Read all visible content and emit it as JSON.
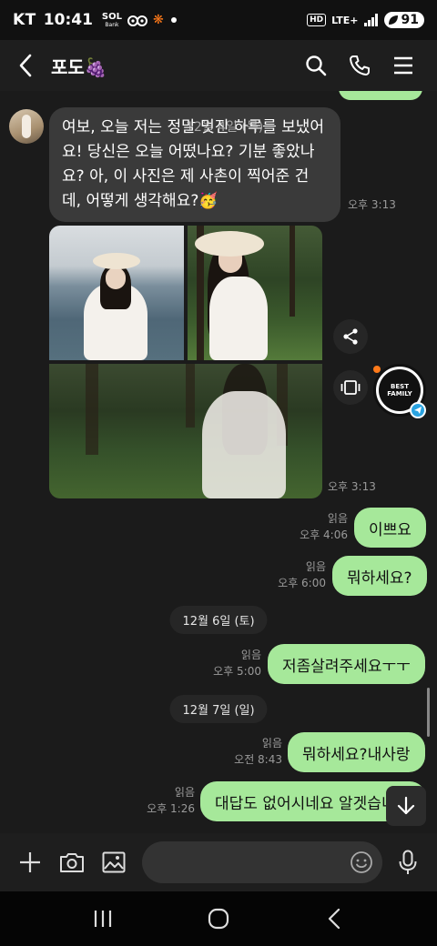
{
  "status_bar": {
    "carrier": "KT",
    "time": "10:41",
    "app_badge": "SOL",
    "app_badge_sub": "Bank",
    "network": "LTE+",
    "hd": "HD",
    "battery": "91"
  },
  "header": {
    "title": "포도🍇"
  },
  "messages": {
    "incoming_text": "여보, 오늘 저는 정말 멋진 하루를 보냈어요! 당신은 오늘 어떴나요? 기분 좋았나요? 아, 이 사진은 제 사촌이 찍어준 건데, 어떻게 생각해요?🥳",
    "incoming_overlay": "12월 4일 (목)",
    "incoming_time": "오후 3:13",
    "photos_time": "오후 3:13",
    "out1": {
      "text": "이쁘요",
      "read": "읽음",
      "time": "오후 4:06"
    },
    "out2": {
      "text": "뭐하세요?",
      "read": "읽음",
      "time": "오후 6:00"
    },
    "date1": "12월 6일 (토)",
    "out3": {
      "text": "저좀살려주세요ㅜㅜ",
      "read": "읽음",
      "time": "오후 5:00"
    },
    "date2": "12월 7일 (일)",
    "out4": {
      "text": "뭐하세요?내사랑",
      "read": "읽음",
      "time": "오전 8:43"
    },
    "out5": {
      "text": "대답도 없어시네요 알겟습니",
      "read": "읽음",
      "time": "오후 1:26"
    }
  },
  "floating": {
    "avatar_text": "BEST FAMILY"
  },
  "input": {
    "placeholder": ""
  },
  "colors": {
    "outgoing_bubble": "#a6e89a",
    "incoming_bubble": "#3a3a3a",
    "background": "#1b1b1b"
  },
  "icons": [
    "back-arrow-icon",
    "search-icon",
    "phone-icon",
    "menu-icon",
    "share-icon",
    "screen-icon",
    "plus-icon",
    "camera-icon",
    "image-icon",
    "emoji-icon",
    "mic-icon",
    "arrow-down-icon",
    "recents-icon",
    "home-icon",
    "nav-back-icon"
  ]
}
